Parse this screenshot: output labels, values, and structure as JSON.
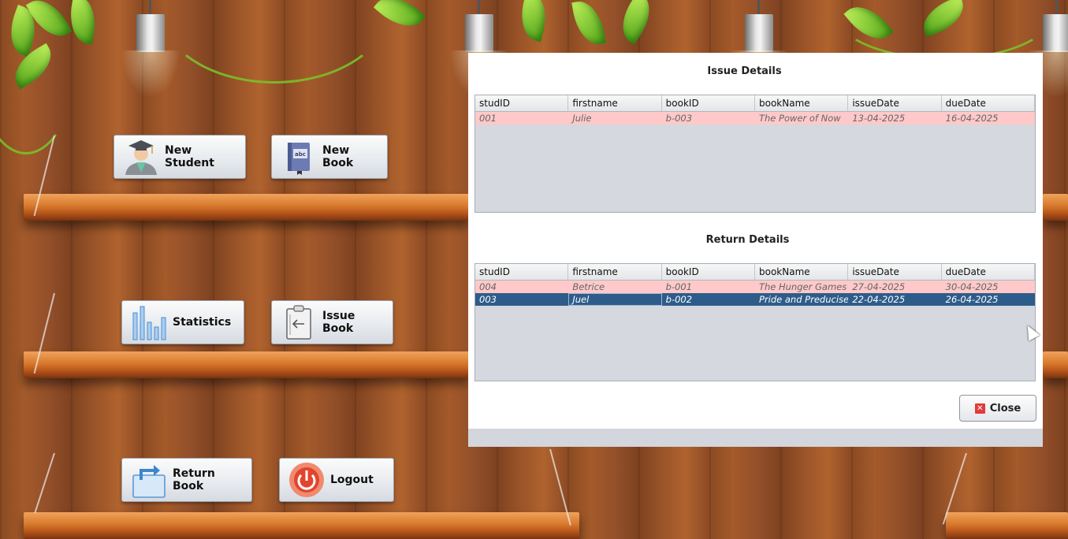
{
  "menu": {
    "new_student": "New Student",
    "new_book": "New Book",
    "statistics": "Statistics",
    "issue_book": "Issue Book",
    "return_book": "Return Book",
    "logout": "Logout"
  },
  "dialog": {
    "issue_title": "Issue Details",
    "return_title": "Return Details",
    "close_label": "Close",
    "columns": [
      "studID",
      "firstname",
      "bookID",
      "bookName",
      "issueDate",
      "dueDate"
    ],
    "issue_rows": [
      [
        "001",
        "Julie",
        "b-003",
        "The Power of Now",
        "13-04-2025",
        "16-04-2025"
      ]
    ],
    "return_rows": [
      [
        "004",
        "Betrice",
        "b-001",
        "The Hunger Games",
        "27-04-2025",
        "30-04-2025"
      ],
      [
        "003",
        "Juel",
        "b-002",
        "Pride and Preducise",
        "22-04-2025",
        "26-04-2025"
      ]
    ]
  },
  "colors": {
    "row_highlight": "#ffc9c9",
    "row_selected": "#2e5c8a",
    "table_bg": "#d5d8de",
    "close_icon": "#e23b3b"
  }
}
